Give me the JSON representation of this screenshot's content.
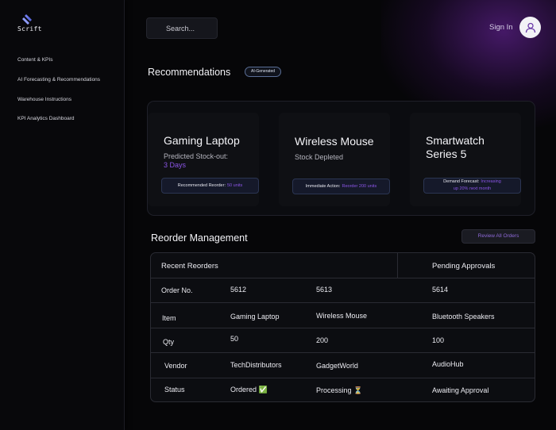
{
  "brand": {
    "name": "Scrift"
  },
  "sidebar": {
    "items": [
      {
        "label": "Content & KPIs"
      },
      {
        "label": "AI Forecasting & Recommendations"
      },
      {
        "label": "Warehouse Instructions"
      },
      {
        "label": "KPI Analytics Dashboard"
      }
    ]
  },
  "header": {
    "search_placeholder": "Search...",
    "signin_label": "Sign In",
    "avatar_icon": "user-icon"
  },
  "recommendations": {
    "title": "Recommendations",
    "badge": "AI-Generated",
    "cards": [
      {
        "title": "Gaming Laptop",
        "subtitle": "Predicted Stock-out:",
        "subtitle_highlight": "3 Days",
        "action_label": "Recommended Reorder:",
        "action_highlight": "50 units"
      },
      {
        "title": "Wireless Mouse",
        "subtitle": "Stock Depleted",
        "subtitle_highlight": "",
        "action_label": "Immediate Action:",
        "action_highlight": "Reorder 200 units"
      },
      {
        "title_line1": "Smartwatch",
        "title_line2": "Series 5",
        "subtitle": "",
        "action_label": "Demand Forecast:",
        "action_highlight_line1": "Increasing",
        "action_highlight_line2": "up 20% next month"
      }
    ]
  },
  "reorder": {
    "title": "Reorder Management",
    "review_button": "Review All Orders",
    "table": {
      "group_headers": [
        "Recent Reorders",
        "Pending Approvals"
      ],
      "rows": [
        {
          "label": "Order No.",
          "values": [
            "5612",
            "5613",
            "5614"
          ]
        },
        {
          "label": "Item",
          "values": [
            "Gaming Laptop",
            "Wireless Mouse",
            "Bluetooth Speakers"
          ]
        },
        {
          "label": "Qty",
          "values": [
            "50",
            "200",
            "100"
          ]
        },
        {
          "label": "Vendor",
          "values": [
            "TechDistributors",
            "GadgetWorld",
            "AudioHub"
          ]
        },
        {
          "label": "Status",
          "values": [
            "Ordered ✅",
            "Processing ⏳",
            "Awaiting Approval"
          ]
        }
      ]
    }
  },
  "colors": {
    "accent": "#8b55e6",
    "background": "#060608",
    "panel": "#0b0c10",
    "badge_border": "#5a6e96"
  }
}
